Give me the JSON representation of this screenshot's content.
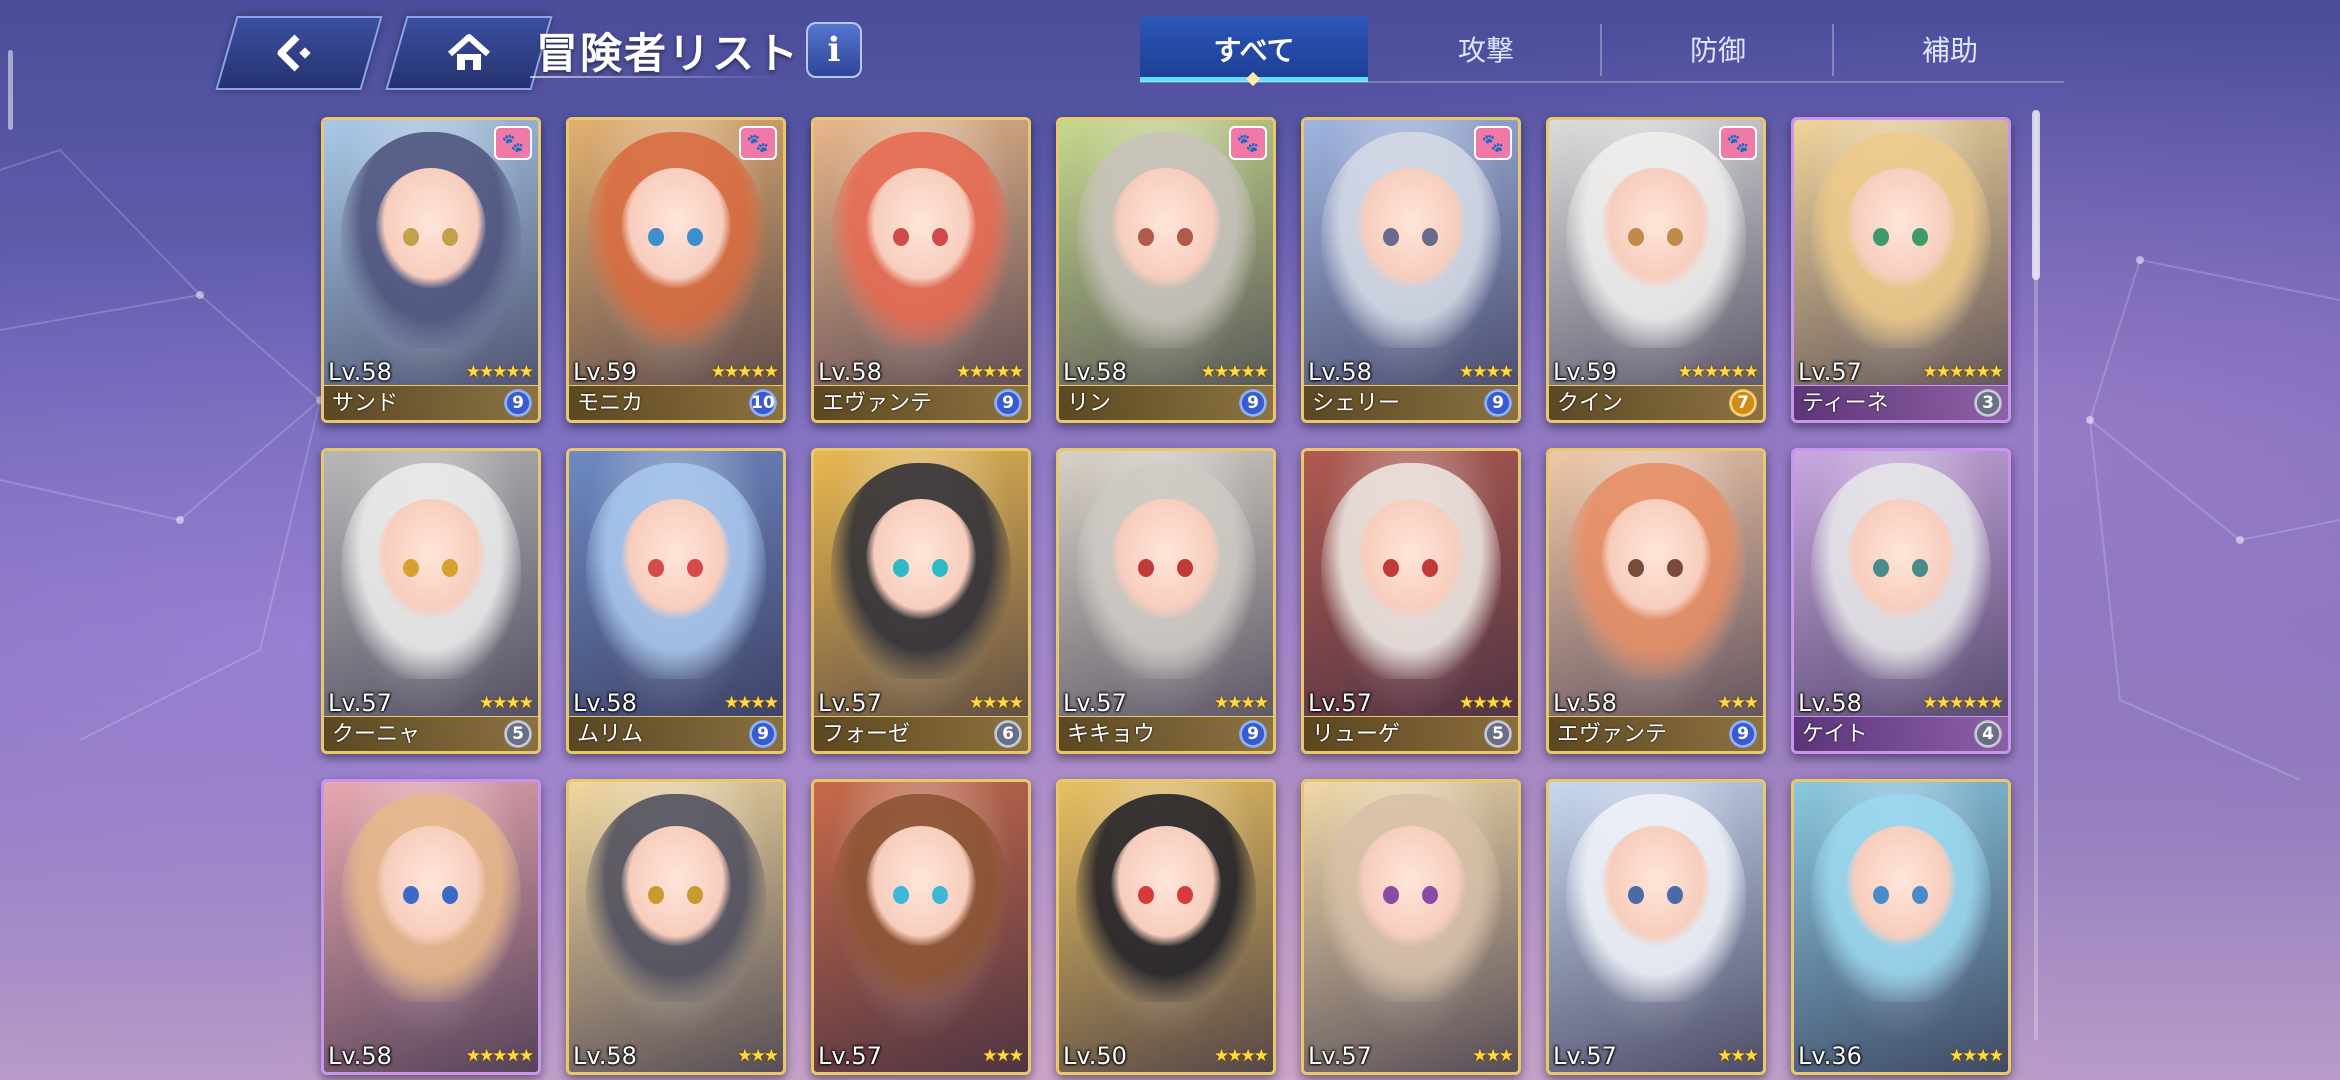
{
  "header": {
    "title": "冒険者リスト",
    "info_label": "i"
  },
  "tabs": [
    {
      "label": "すべて",
      "active": true
    },
    {
      "label": "攻撃",
      "active": false
    },
    {
      "label": "防御",
      "active": false
    },
    {
      "label": "補助",
      "active": false
    }
  ],
  "colors": {
    "accent": "#5fe0ff",
    "card_gold": "#e9c86b",
    "card_purple": "#c993f0",
    "star": "#ffd84a"
  },
  "characters": [
    {
      "level": "Lv.58",
      "stars": 5,
      "name": "サンド",
      "badge": "9",
      "pet": true,
      "frame": "gold",
      "bg": "#a9c9e8",
      "hair": "#4a4f7a",
      "eye": "#c4a04a"
    },
    {
      "level": "Lv.59",
      "stars": 5,
      "name": "モニカ",
      "badge": "10",
      "pet": true,
      "frame": "gold",
      "bg": "#e3b070",
      "hair": "#d9683c",
      "eye": "#3e8ecf"
    },
    {
      "level": "Lv.58",
      "stars": 5,
      "name": "エヴァンテ",
      "badge": "9",
      "pet": false,
      "frame": "gold",
      "bg": "#e8b68a",
      "hair": "#e8664e",
      "eye": "#d14a4a"
    },
    {
      "level": "Lv.58",
      "stars": 5,
      "name": "リン",
      "badge": "9",
      "pet": true,
      "frame": "gold",
      "bg": "#c7d98e",
      "hair": "#c8c2bc",
      "eye": "#b05a4a"
    },
    {
      "level": "Lv.58",
      "stars": 4,
      "name": "シェリー",
      "badge": "9",
      "pet": true,
      "frame": "gold",
      "bg": "#9fb4e0",
      "hair": "#d6dbe6",
      "eye": "#6a6a8a"
    },
    {
      "level": "Lv.59",
      "stars": 6,
      "name": "クイン",
      "badge": "7",
      "badgeType": "gold",
      "pet": true,
      "frame": "gold",
      "bg": "#dcdcdc",
      "hair": "#f1f0ee",
      "eye": "#c08a4a"
    },
    {
      "level": "Lv.57",
      "stars": 6,
      "name": "ティーネ",
      "badge": "3",
      "badgeType": "grey",
      "pet": false,
      "frame": "purple",
      "bg": "#f0d49a",
      "hair": "#efc988",
      "eye": "#3e9a6a"
    },
    {
      "level": "Lv.57",
      "stars": 4,
      "name": "クーニャ",
      "badge": "5",
      "badgeType": "grey",
      "pet": false,
      "frame": "gold",
      "bg": "#b8b8b8",
      "hair": "#eeeeee",
      "eye": "#d8a030"
    },
    {
      "level": "Lv.58",
      "stars": 4,
      "name": "ムリム",
      "badge": "9",
      "pet": false,
      "frame": "gold",
      "bg": "#6e8ac4",
      "hair": "#a9c8ef",
      "eye": "#d64a4a"
    },
    {
      "level": "Lv.57",
      "stars": 4,
      "name": "フォーゼ",
      "badge": "6",
      "badgeType": "grey",
      "pet": false,
      "frame": "gold",
      "bg": "#e8b850",
      "hair": "#2a2a34",
      "eye": "#2fb8c8"
    },
    {
      "level": "Lv.57",
      "stars": 4,
      "name": "キキョウ",
      "badge": "9",
      "pet": false,
      "frame": "gold",
      "bg": "#d8d2c6",
      "hair": "#cfcac4",
      "eye": "#c03a3a"
    },
    {
      "level": "Lv.57",
      "stars": 4,
      "name": "リューゲ",
      "badge": "5",
      "badgeType": "grey",
      "pet": false,
      "frame": "gold",
      "bg": "#b05a50",
      "hair": "#f0ebe6",
      "eye": "#c03a3a"
    },
    {
      "level": "Lv.58",
      "stars": 3,
      "name": "エヴァンテ",
      "badge": "9",
      "pet": false,
      "frame": "gold",
      "bg": "#f0c8a8",
      "hair": "#e88c62",
      "eye": "#7a4a3a"
    },
    {
      "level": "Lv.58",
      "stars": 6,
      "name": "ケイト",
      "badge": "4",
      "badgeType": "grey",
      "pet": false,
      "frame": "purple",
      "bg": "#c8a8e0",
      "hair": "#e8e8ea",
      "eye": "#4a8a8a"
    },
    {
      "level": "Lv.58",
      "stars": 5,
      "name": "",
      "badge": "",
      "pet": false,
      "frame": "purple",
      "bg": "#e8a8b0",
      "hair": "#e8b888",
      "eye": "#3a6ac8"
    },
    {
      "level": "Lv.58",
      "stars": 3,
      "name": "",
      "badge": "",
      "pet": false,
      "frame": "gold",
      "bg": "#f0d8a0",
      "hair": "#4a4a5a",
      "eye": "#c89a30"
    },
    {
      "level": "Lv.57",
      "stars": 3,
      "name": "",
      "badge": "",
      "pet": false,
      "frame": "gold",
      "bg": "#c86a4a",
      "hair": "#8a5030",
      "eye": "#3ab8d8"
    },
    {
      "level": "Lv.50",
      "stars": 4,
      "name": "",
      "badge": "",
      "pet": false,
      "frame": "gold",
      "bg": "#e8c060",
      "hair": "#1a1a22",
      "eye": "#d83a3a"
    },
    {
      "level": "Lv.57",
      "stars": 3,
      "name": "",
      "badge": "",
      "pet": false,
      "frame": "gold",
      "bg": "#f0d8a8",
      "hair": "#d8c0a8",
      "eye": "#8a4aa8"
    },
    {
      "level": "Lv.57",
      "stars": 3,
      "name": "",
      "badge": "",
      "pet": false,
      "frame": "gold",
      "bg": "#c8d8f0",
      "hair": "#f0f4fa",
      "eye": "#4a6aa8"
    },
    {
      "level": "Lv.36",
      "stars": 4,
      "name": "",
      "badge": "",
      "pet": false,
      "frame": "gold",
      "bg": "#8ac8e0",
      "hair": "#9ad8f0",
      "eye": "#4a8ac8"
    }
  ]
}
